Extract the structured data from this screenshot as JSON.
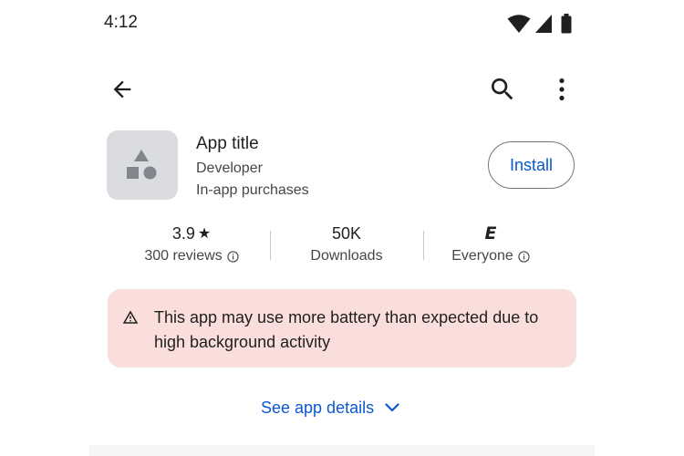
{
  "status_bar": {
    "time": "4:12",
    "icons": [
      "wifi-icon",
      "cellular-signal-icon",
      "battery-icon"
    ]
  },
  "top_bar": {
    "icons": [
      "arrow-back-icon",
      "search-icon",
      "more-vert-icon"
    ]
  },
  "app": {
    "title": "App title",
    "developer": "Developer",
    "purchases": "In-app purchases",
    "install_label": "Install",
    "icon": "shapes-icon"
  },
  "stats": {
    "rating": {
      "value": "3.9",
      "star": "★",
      "reviews": "300 reviews"
    },
    "downloads": {
      "value": "50K",
      "label": "Downloads"
    },
    "content_rating": {
      "badge": "E",
      "label": "Everyone"
    }
  },
  "warning": {
    "icon": "warning-icon",
    "text": "This app may use more battery than expected due to high background activity"
  },
  "details": {
    "label": "See app details",
    "icon": "chevron-down-icon"
  },
  "colors": {
    "accent": "#0b57d0",
    "warning_bg": "#f9dedc",
    "icon_bg": "#dadce0"
  }
}
